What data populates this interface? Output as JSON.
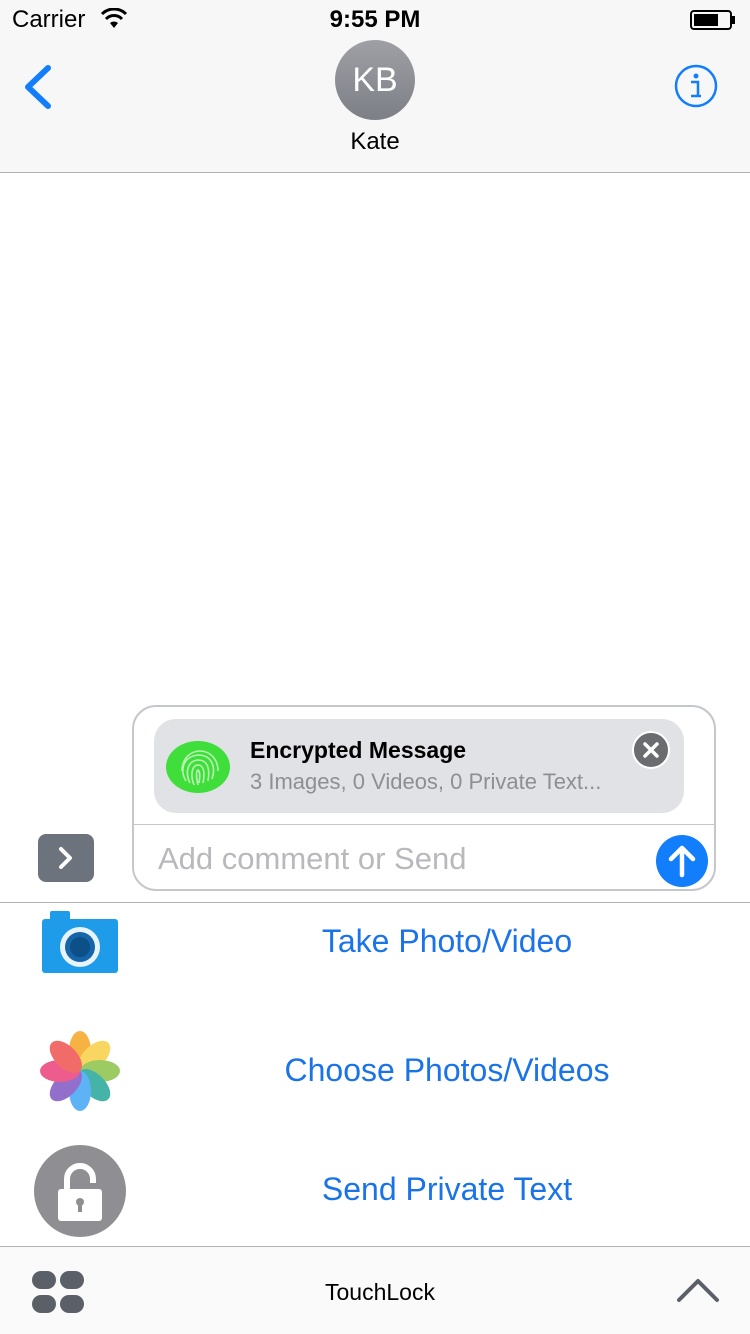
{
  "status_bar": {
    "carrier": "Carrier",
    "time": "9:55 PM",
    "icons": [
      "wifi-icon",
      "battery-icon"
    ]
  },
  "nav": {
    "back_icon": "chevron-left-icon",
    "avatar_initials": "KB",
    "contact_name": "Kate",
    "info_icon": "info-icon"
  },
  "compose": {
    "attachment": {
      "title": "Encrypted Message",
      "subtitle": "3 Images, 0 Videos, 0 Private Text...",
      "icon": "fingerprint-icon"
    },
    "comment_placeholder": "Add comment or Send",
    "comment_value": "",
    "send_icon": "arrow-up-icon"
  },
  "drawer": {
    "items": [
      {
        "label": "Take Photo/Video",
        "icon": "camera-icon"
      },
      {
        "label": "Choose Photos/Videos",
        "icon": "photos-icon"
      },
      {
        "label": "Send Private Text",
        "icon": "lock-icon"
      }
    ]
  },
  "bottom_bar": {
    "app_name": "TouchLock",
    "apps_icon": "apps-grid-icon",
    "collapse_icon": "chevron-up-icon"
  },
  "colors": {
    "accent": "#127efb",
    "link": "#1a73e8",
    "attachment_bg": "#e1e2e6",
    "fingerprint": "#3fde3b"
  }
}
